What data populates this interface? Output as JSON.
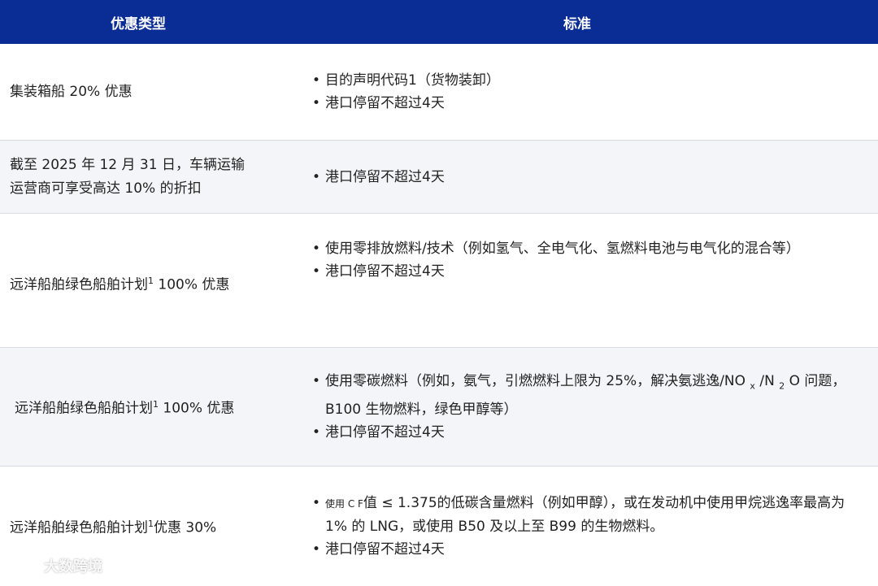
{
  "header": {
    "col1": "优惠类型",
    "col2": "标准"
  },
  "rows": [
    {
      "type_lines": [
        "集装箱船 20% 优惠"
      ],
      "criteria": [
        "目的声明代码1（货物装卸）",
        "港口停留不超过4天"
      ]
    },
    {
      "type_lines": [
        "截至 2025 年 12 月 31 日，车辆运输",
        "运营商可享受高达 10% 的折扣"
      ],
      "criteria": [
        "港口停留不超过4天"
      ]
    },
    {
      "type_main": "远洋船舶绿色船舶计划",
      "type_sup": "1",
      "type_tail": " 100% 优惠",
      "criteria": [
        "使用零排放燃料/技术（例如氢气、全电气化、氢燃料电池与电气化的混合等）",
        "港口停留不超过4天"
      ]
    },
    {
      "type_main": "远洋船舶绿色船舶计划",
      "type_sup": "1",
      "type_tail": " 100% 优惠",
      "criteria_1_a": "使用零碳燃料（例如，氨气，引燃燃料上限为 25%，解决氨逃逸/NO ",
      "criteria_1_sub_x": "x",
      "criteria_1_b": " /N ",
      "criteria_1_sub_2": "2",
      "criteria_1_c": " O 问题，B100 生物燃料，绿色甲醇等）",
      "criteria_2": "港口停留不超过4天"
    },
    {
      "type_main": "远洋船舶绿色船舶计划",
      "type_sup": "1",
      "type_tail": "优惠 30%",
      "criteria_1_small": "使用 C F",
      "criteria_1_rest": "值 ≤ 1.375的低碳含量燃料（例如甲醇），或在发动机中使用甲烷逃逸率最高为 1% 的 LNG，或使用 B50 及以上至 B99 的生物燃料。",
      "criteria_2": "港口停留不超过4天"
    }
  ],
  "watermark": {
    "text": "大数跨境",
    "icon": "logo-icon"
  }
}
